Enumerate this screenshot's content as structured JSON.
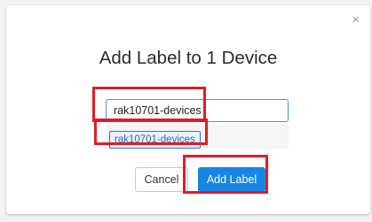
{
  "dialog": {
    "title": "Add Label to 1 Device",
    "close_symbol": "×",
    "input": {
      "value": "rak10701-devices"
    },
    "suggestion": {
      "label": "rak10701-devices"
    },
    "cancel_label": "Cancel",
    "add_label": "Add Label"
  },
  "colors": {
    "primary_button": "#1686e6",
    "highlight_border": "#e31b23",
    "chip_border": "#2f74c6",
    "chip_background": "#e8f0fb"
  },
  "icons": {
    "close": "close-icon"
  }
}
